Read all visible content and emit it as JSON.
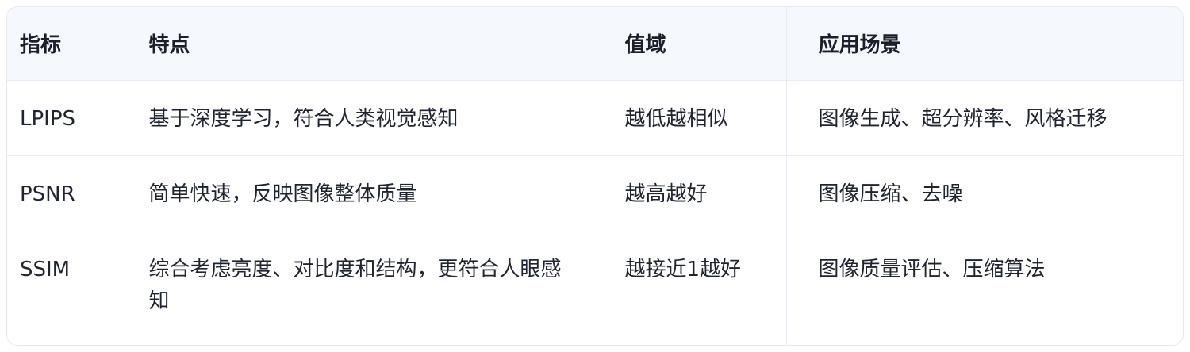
{
  "table": {
    "headers": [
      "指标",
      "特点",
      "值域",
      "应用场景"
    ],
    "rows": [
      {
        "metric": "LPIPS",
        "feature": "基于深度学习，符合人类视觉感知",
        "range": "越低越相似",
        "scene": "图像生成、超分辨率、风格迁移"
      },
      {
        "metric": "PSNR",
        "feature": "简单快速，反映图像整体质量",
        "range": "越高越好",
        "scene": "图像压缩、去噪"
      },
      {
        "metric": "SSIM",
        "feature": "综合考虑亮度、对比度和结构，更符合人眼感知",
        "range": "越接近1越好",
        "scene": "图像质量评估、压缩算法"
      }
    ]
  }
}
